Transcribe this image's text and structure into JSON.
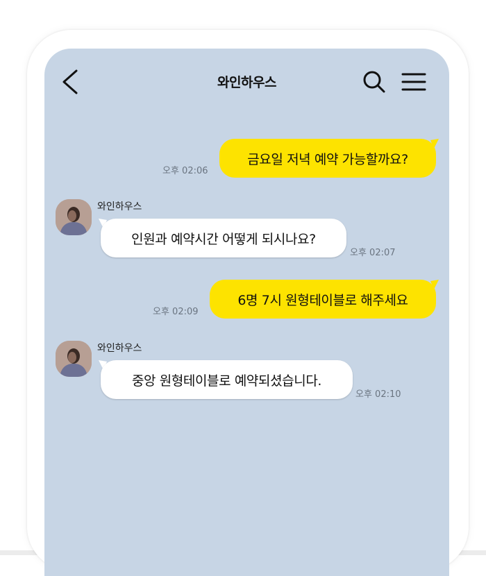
{
  "header": {
    "title": "와인하우스",
    "back_icon": "chevron-left-icon",
    "search_icon": "search-icon",
    "menu_icon": "hamburger-menu-icon"
  },
  "colors": {
    "chat_background": "#c7d5e5",
    "outgoing_bubble": "#fde300",
    "incoming_bubble": "#ffffff"
  },
  "messages": [
    {
      "direction": "outgoing",
      "text": "금요일 저녁 예약 가능할까요?",
      "time": "오후 02:06"
    },
    {
      "direction": "incoming",
      "sender": "와인하우스",
      "text": "인원과 예약시간 어떻게 되시나요?",
      "time": "오후 02:07"
    },
    {
      "direction": "outgoing",
      "text": "6명 7시 원형테이블로 해주세요",
      "time": "오후 02:09"
    },
    {
      "direction": "incoming",
      "sender": "와인하우스",
      "text": "중앙 원형테이블로 예약되셨습니다.",
      "time": "오후 02:10"
    }
  ]
}
